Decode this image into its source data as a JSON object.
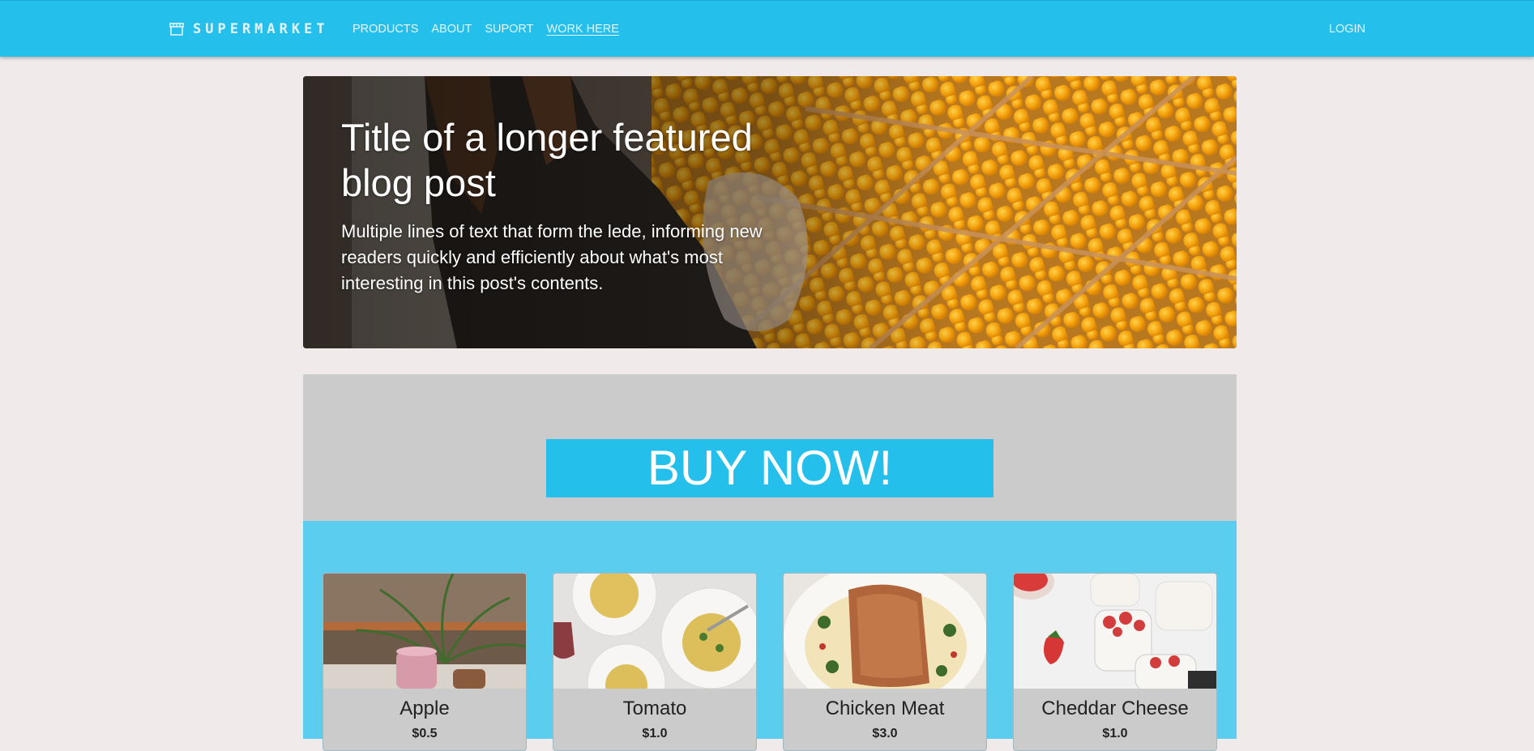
{
  "navbar": {
    "brand": "SUPERMARKET",
    "brand_icon": "store-icon",
    "links": [
      "PRODUCTS",
      "ABOUT",
      "SUPORT",
      "WORK HERE"
    ],
    "login": "LOGIN",
    "color": "#24bfeb"
  },
  "hero": {
    "title": "Title of a longer featured blog post",
    "lede": "Multiple lines of text that form the lede, informing new readers quickly and efficiently about what's most interesting in this post's contents.",
    "image": "produce-market-photo"
  },
  "buy": {
    "label": "BUY NOW!",
    "button_color": "#24bfeb",
    "section_color": "#cbcbcb"
  },
  "products": {
    "background": "#5bcdef",
    "items": [
      {
        "name": "Apple",
        "price": "$0.5",
        "image": "pink-cup-plant-photo"
      },
      {
        "name": "Tomato",
        "price": "$1.0",
        "image": "pasta-plates-photo"
      },
      {
        "name": "Chicken Meat",
        "price": "$3.0",
        "image": "grilled-meat-photo"
      },
      {
        "name": "Cheddar Cheese",
        "price": "$1.0",
        "image": "strawberry-yogurt-photo"
      }
    ]
  }
}
